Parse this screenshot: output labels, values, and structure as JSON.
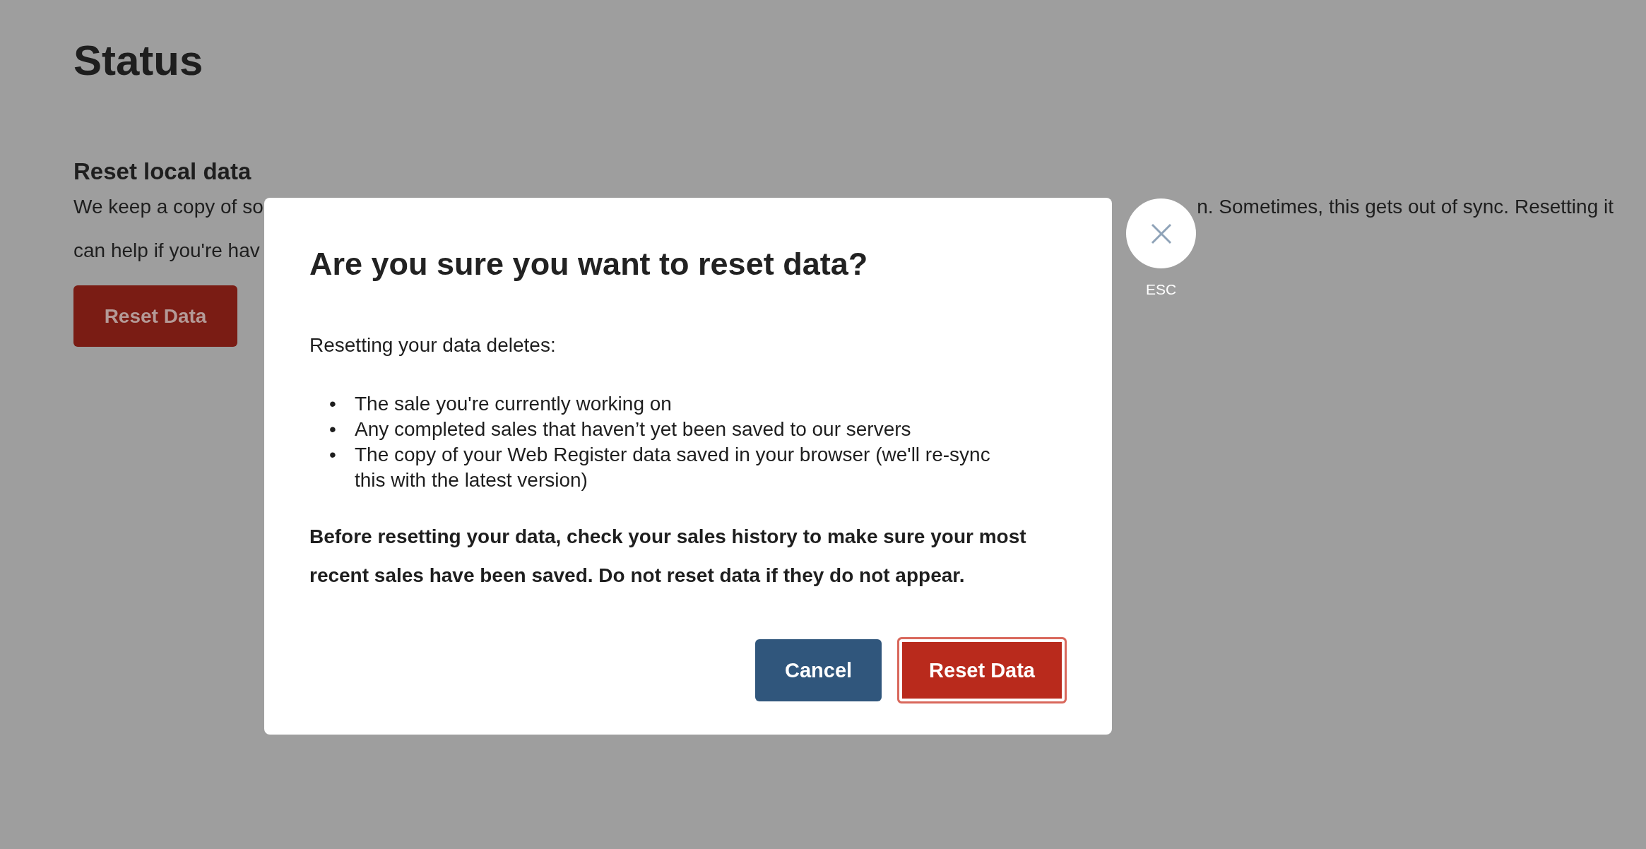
{
  "page": {
    "title": "Status"
  },
  "section": {
    "heading": "Reset local data",
    "description": {
      "line_1_left": "We keep a copy of so",
      "line_1_right": "n. Sometimes, this gets out of sync. Resetting it",
      "line_2_left": "can help if you're hav"
    },
    "button": "Reset Data"
  },
  "dialog": {
    "title": "Are you sure you want to reset data?",
    "intro": "Resetting your data deletes:",
    "items": [
      {
        "bullet": "•",
        "text": "The sale you're currently working on"
      },
      {
        "bullet": "•",
        "text": "Any completed sales that haven’t yet been saved to our servers"
      },
      {
        "bullet": "•",
        "text": "The copy of your Web Register data saved in your browser (we'll re-sync this with the latest version)"
      }
    ],
    "warning": "Before resetting your data, check your sales history to make sure your most recent sales have been saved. Do not reset data if they do not appear.",
    "buttons": [
      {
        "label": "Cancel",
        "kind": "secondary",
        "focused": false
      },
      {
        "label": "Reset Data",
        "kind": "danger",
        "focused": true
      }
    ]
  },
  "close": {
    "hint": "ESC"
  }
}
